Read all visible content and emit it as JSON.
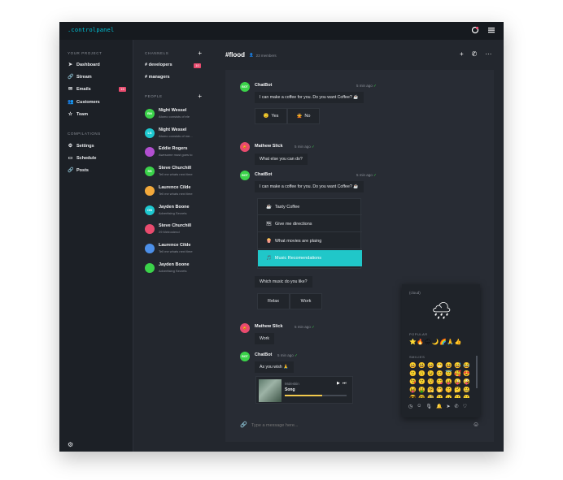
{
  "brand": ".controlpanel",
  "nav": {
    "project_label": "YOUR PROJECT",
    "items": [
      {
        "label": "Dashboard",
        "icon": "send-icon"
      },
      {
        "label": "Stream",
        "icon": "link-icon"
      },
      {
        "label": "Emails",
        "icon": "mail-icon",
        "badge": "15"
      },
      {
        "label": "Customers",
        "icon": "users-icon"
      },
      {
        "label": "Team",
        "icon": "star-icon"
      }
    ],
    "compilations_label": "COMPILATIONS",
    "compilations": [
      {
        "label": "Settings",
        "icon": "gear-icon"
      },
      {
        "label": "Schedule",
        "icon": "calendar-icon"
      },
      {
        "label": "Posts",
        "icon": "link-icon"
      }
    ]
  },
  "channels": {
    "label": "CHANNELS",
    "items": [
      {
        "label": "# developers",
        "badge": "10"
      },
      {
        "label": "# managers"
      }
    ],
    "people_label": "PEOPLE",
    "people": [
      {
        "name": "Night Wessel",
        "message": "Atomo consists of ele",
        "initials": "BN",
        "color": "#3bd34a"
      },
      {
        "name": "Night Wessel",
        "message": "Atomo consists of me...",
        "initials": "LS",
        "color": "#1ec8d0"
      },
      {
        "name": "Eddie Rogers",
        "message": "Awesome must goes to",
        "initials": "",
        "color": "#b24fd1"
      },
      {
        "name": "Steve Churchill",
        "message": "Tell me whats next time",
        "initials": "SS",
        "color": "#3bd34a"
      },
      {
        "name": "Laurence Cilde",
        "message": "Tell me whats next time",
        "initials": "",
        "color": "#f3a93b"
      },
      {
        "name": "Jayden Boone",
        "message": "Advertising Secrets",
        "initials": "ON",
        "color": "#1ec8d0"
      },
      {
        "name": "Steve Churchill",
        "message": "29 Metrostend",
        "initials": "",
        "color": "#e94b6e"
      },
      {
        "name": "Laurence Cilde",
        "message": "Tell me whats next time",
        "initials": "",
        "color": "#4c8fe8"
      },
      {
        "name": "Jayden Boone",
        "message": "Advertising Secrets",
        "initials": "",
        "color": "#3bd34a"
      }
    ]
  },
  "header": {
    "title": "#flood",
    "members": "23 members"
  },
  "messages": {
    "bot_name": "ChatBot",
    "bot_avatar": "BOT",
    "time1": "5 min ago",
    "text1": "I can make a coffee for you. Do you want Coffee? ☕",
    "yes": "Yes",
    "no": "No",
    "user_name": "Mathew Slick",
    "time2": "5 min ago",
    "text2": "What else you can do?",
    "time3": "5 min ago",
    "text3": "I can make a coffee for you. Do you want Coffee? ☕",
    "menu": [
      "Tasty Coffee",
      "Give me directions",
      "What movies are plaing",
      "Music Recomendations"
    ],
    "text4": "Which music do you like?",
    "relax": "Relax",
    "work": "Work",
    "time5": "5 min ago",
    "text5": "Work",
    "time6": "5 min ago",
    "text6": "As you wish 🙏",
    "player_artist": "Moleskin",
    "player_song": "Song",
    "player_progress": 0.6
  },
  "composer": {
    "placeholder": "Type a message here..."
  },
  "emoji_panel": {
    "header": "(cloud)",
    "preview": "🌧",
    "popular_label": "POPULAR",
    "popular": "⭐🔥🌧🌙🌈🙏👍",
    "smileys_label": "SMILIES",
    "smileys": [
      "😀",
      "😃",
      "😄",
      "😁",
      "😆",
      "😅",
      "😂",
      "🙂",
      "🙃",
      "😉",
      "😊",
      "😇",
      "🥰",
      "😍",
      "😘",
      "😗",
      "😚",
      "😋",
      "😛",
      "😜",
      "🤪",
      "😝",
      "🤑",
      "🤗",
      "🤭",
      "🤫",
      "🤔",
      "🤐",
      "😎",
      "🤓",
      "🧐",
      "😕",
      "😟",
      "🙁",
      "😮"
    ]
  }
}
